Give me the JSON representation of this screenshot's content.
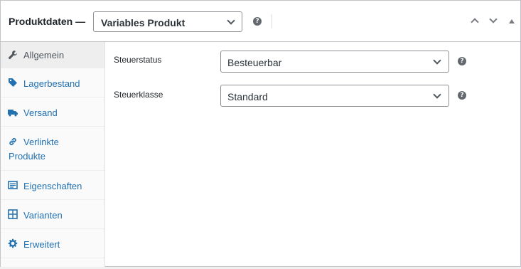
{
  "header": {
    "title": "Produktdaten —",
    "product_type": "Variables Produkt",
    "help": "?"
  },
  "tabs": [
    {
      "label": "Allgemein",
      "icon": "wrench-icon",
      "active": true
    },
    {
      "label": "Lagerbestand",
      "icon": "tag-icon"
    },
    {
      "label": "Versand",
      "icon": "truck-icon"
    },
    {
      "label_line1": "Verlinkte",
      "label_line2": "Produkte",
      "icon": "link-icon"
    },
    {
      "label": "Eigenschaften",
      "icon": "list-icon"
    },
    {
      "label": "Varianten",
      "icon": "grid-icon"
    },
    {
      "label": "Erweitert",
      "icon": "gear-icon"
    }
  ],
  "fields": {
    "tax_status": {
      "label": "Steuerstatus",
      "value": "Besteuerbar"
    },
    "tax_class": {
      "label": "Steuerklasse",
      "value": "Standard"
    }
  },
  "colors": {
    "accent": "#2271b1",
    "active_tab_bg": "#eeeeee"
  }
}
